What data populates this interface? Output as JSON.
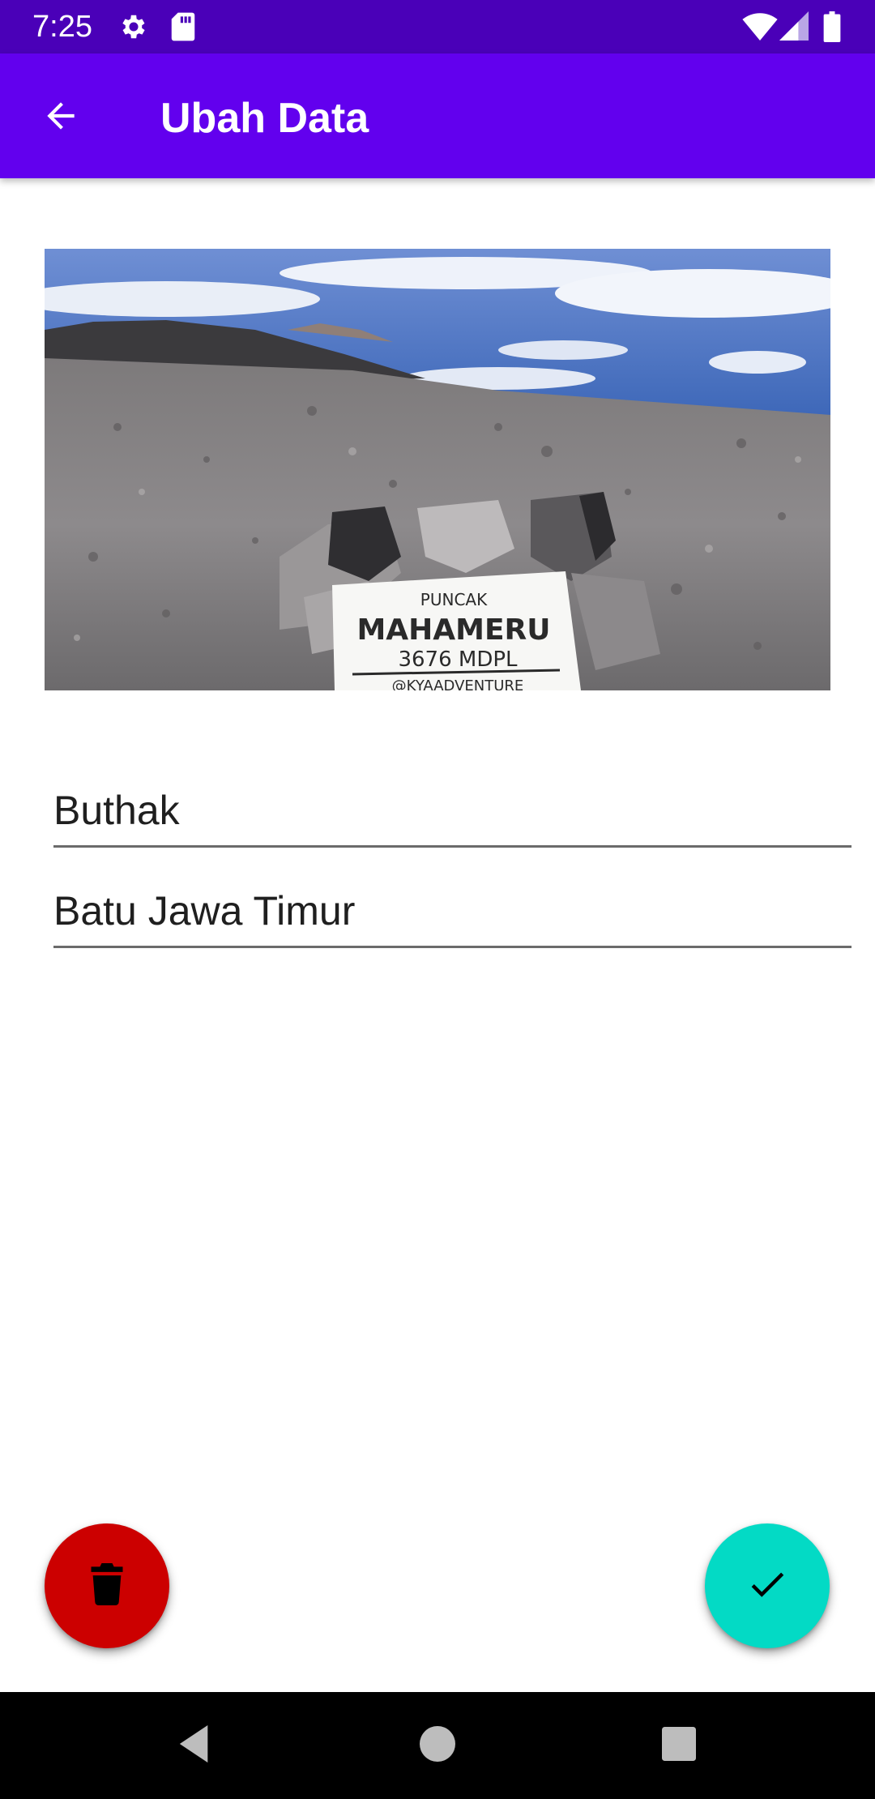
{
  "status_bar": {
    "time": "7:25",
    "icons": [
      "gear-icon",
      "sd-card-icon",
      "wifi-icon",
      "signal-icon",
      "battery-icon"
    ]
  },
  "app_bar": {
    "title": "Ubah Data",
    "back_icon": "arrow-back-icon"
  },
  "photo": {
    "sign_line1": "PUNCAK",
    "sign_line2": "MAHAMERU",
    "sign_line3": "3676 MDPL",
    "sign_line4": "@KYAADVENTURE"
  },
  "form": {
    "name_value": "Buthak",
    "city_value": "Batu Jawa Timur"
  },
  "actions": {
    "delete_icon": "trash-icon",
    "save_icon": "check-icon"
  },
  "colors": {
    "status_bar": "#4a00b8",
    "app_bar": "#6200ee",
    "delete_fab": "#cc0000",
    "save_fab": "#03dac5"
  },
  "nav_bar": {
    "icons": [
      "back-triangle-icon",
      "home-circle-icon",
      "recents-square-icon"
    ]
  }
}
